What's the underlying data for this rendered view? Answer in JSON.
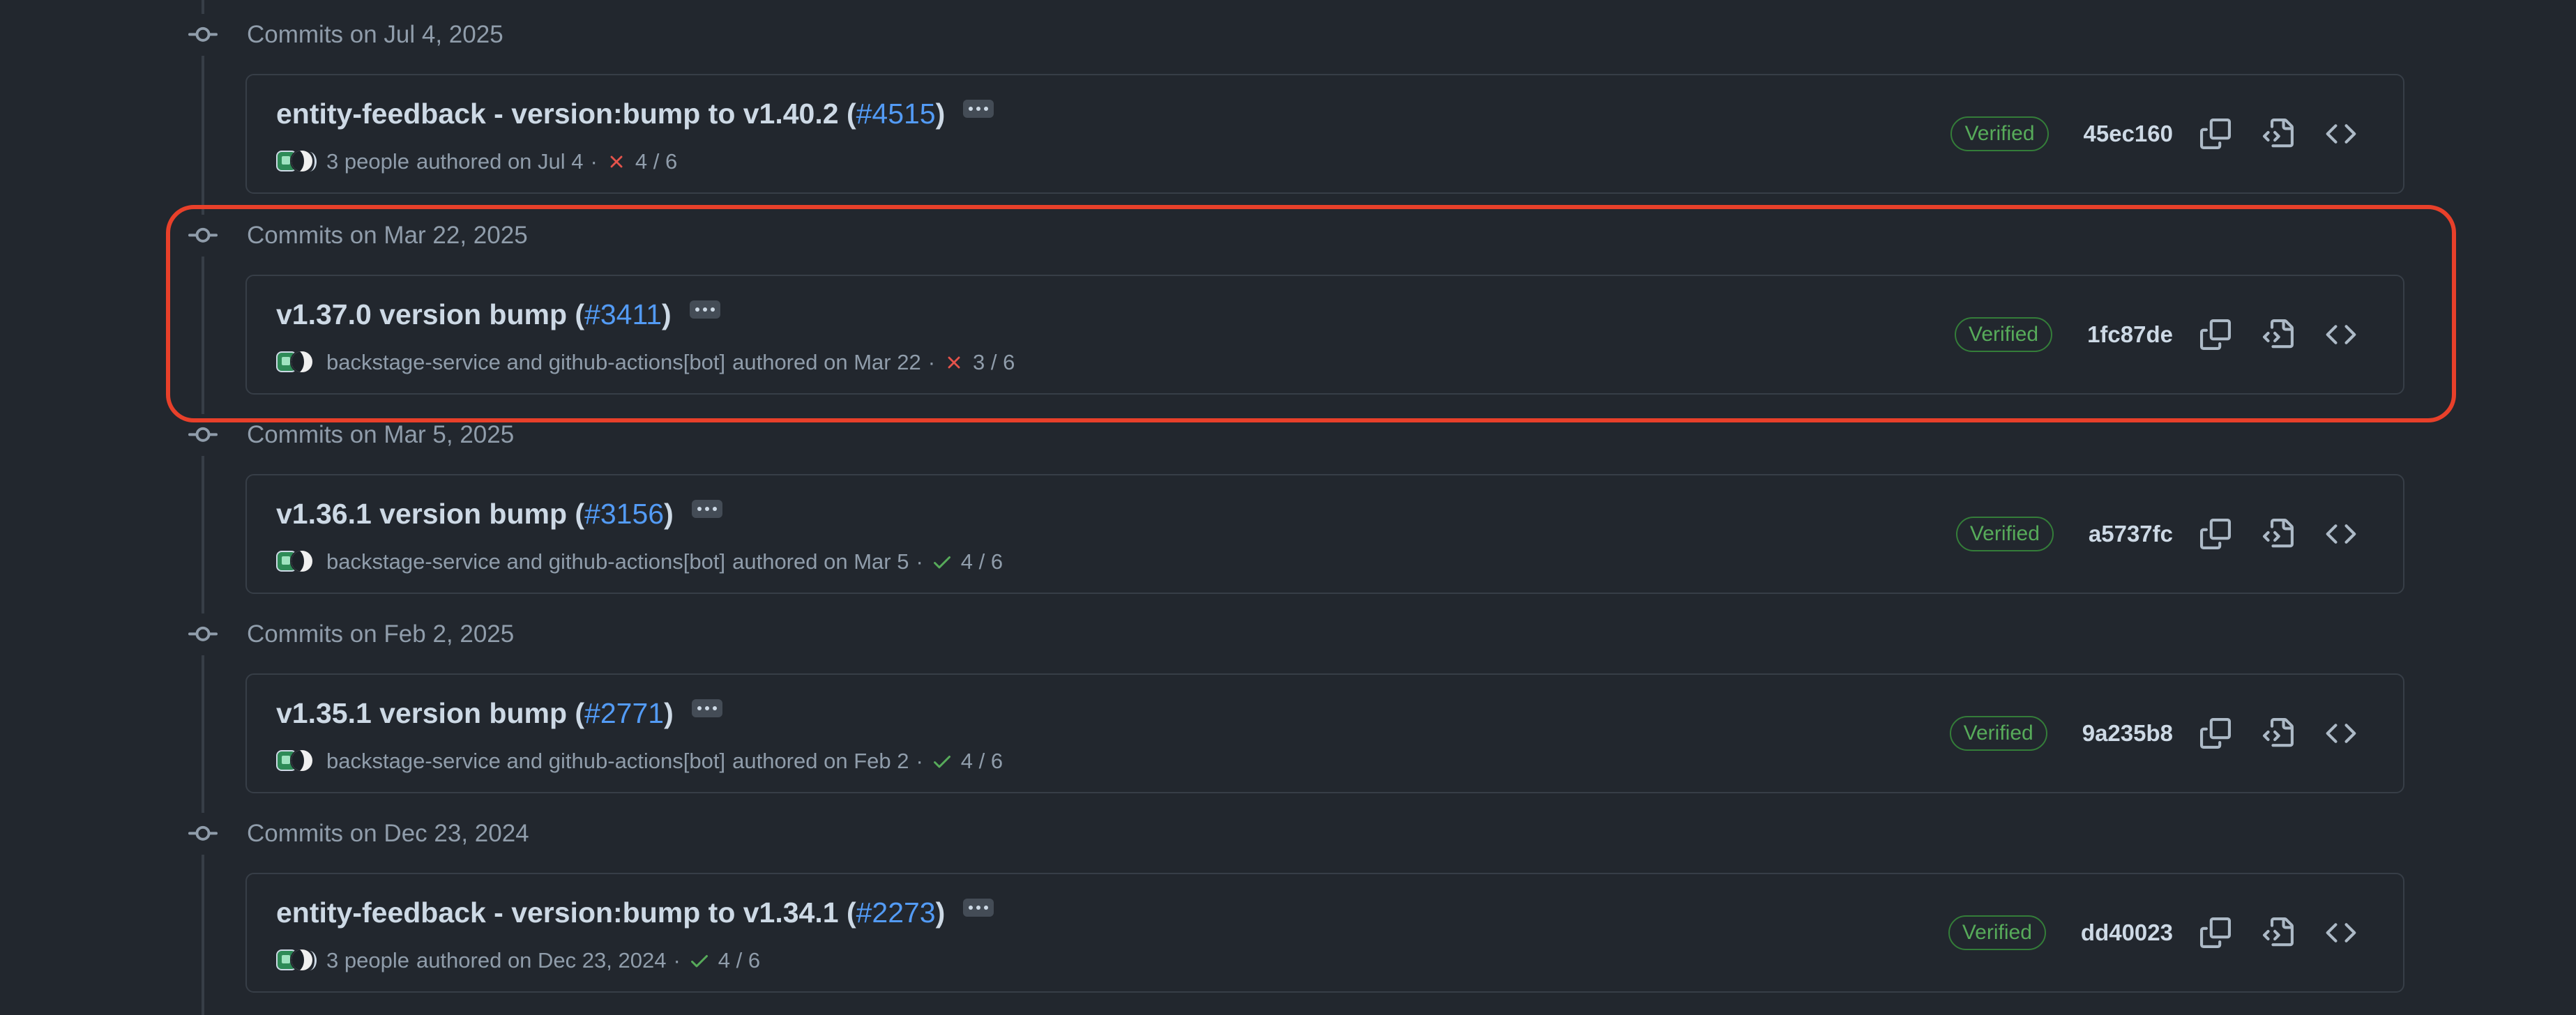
{
  "groups": [
    {
      "header": "Commits on Jul 4, 2025",
      "commit": {
        "title_text": "entity-feedback - version:bump to v1.40.2 (",
        "pr_link": "#4515",
        "title_close": ")",
        "authors": "3 people",
        "authored": "authored on Jul 4",
        "dot": "·",
        "status": "fail",
        "checks": "4 / 6",
        "verified": "Verified",
        "sha": "45ec160"
      }
    },
    {
      "header": "Commits on Mar 22, 2025",
      "commit": {
        "title_text": "v1.37.0 version bump (",
        "pr_link": "#3411",
        "title_close": ")",
        "authors": "backstage-service and github-actions[bot]",
        "authored": "authored on Mar 22",
        "dot": "·",
        "status": "fail",
        "checks": "3 / 6",
        "verified": "Verified",
        "sha": "1fc87de"
      }
    },
    {
      "header": "Commits on Mar 5, 2025",
      "commit": {
        "title_text": "v1.36.1 version bump (",
        "pr_link": "#3156",
        "title_close": ")",
        "authors": "backstage-service and github-actions[bot]",
        "authored": "authored on Mar 5",
        "dot": "·",
        "status": "success",
        "checks": "4 / 6",
        "verified": "Verified",
        "sha": "a5737fc"
      }
    },
    {
      "header": "Commits on Feb 2, 2025",
      "commit": {
        "title_text": "v1.35.1 version bump (",
        "pr_link": "#2771",
        "title_close": ")",
        "authors": "backstage-service and github-actions[bot]",
        "authored": "authored on Feb 2",
        "dot": "·",
        "status": "success",
        "checks": "4 / 6",
        "verified": "Verified",
        "sha": "9a235b8"
      }
    },
    {
      "header": "Commits on Dec 23, 2024",
      "commit": {
        "title_text": "entity-feedback - version:bump to v1.34.1 (",
        "pr_link": "#2273",
        "title_close": ")",
        "authors": "3 people",
        "authored": "authored on Dec 23, 2024",
        "dot": "·",
        "status": "success",
        "checks": "4 / 6",
        "verified": "Verified",
        "sha": "dd40023"
      }
    }
  ],
  "colors": {
    "background": "#22272e",
    "border": "#373e47",
    "link": "#539bf5",
    "verified": "#57ab5a",
    "fail": "#e5534b",
    "success": "#57ab5a",
    "highlight": "#e8402a"
  },
  "icons": {
    "commit_node": "git-commit-icon",
    "copy": "copy-icon",
    "browse_files": "file-code-icon",
    "browse_repo": "code-icon",
    "ellipsis": "kebab-horizontal-icon",
    "fail": "x-icon",
    "success": "check-icon"
  }
}
